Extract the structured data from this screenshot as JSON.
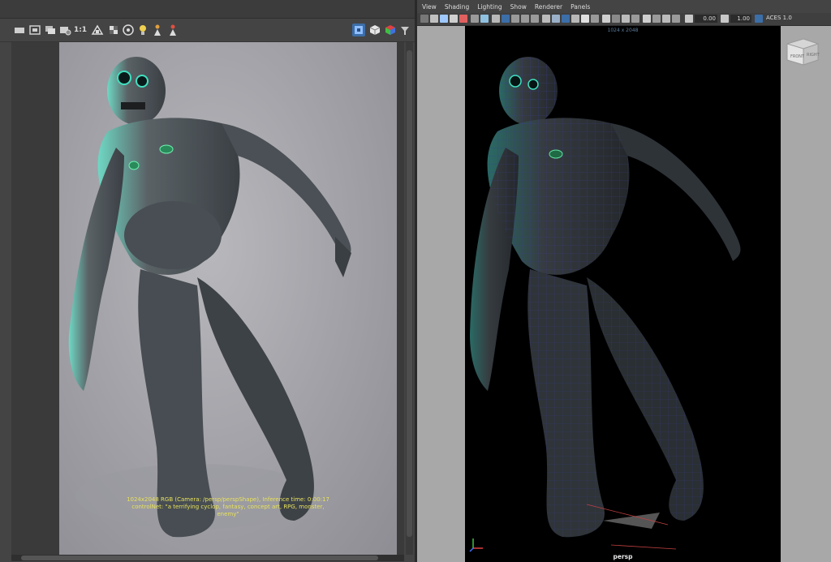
{
  "left_panel": {
    "toolbar": {
      "items": [
        {
          "name": "render-region-icon"
        },
        {
          "name": "snapshot-icon"
        },
        {
          "name": "keep-image-icon"
        },
        {
          "name": "render-settings-icon"
        },
        {
          "name": "real-size-toggle",
          "label": "1:1"
        },
        {
          "name": "color-channels-icon"
        },
        {
          "name": "checker-icon"
        },
        {
          "name": "exposure-icon"
        },
        {
          "name": "light-bulb-icon"
        },
        {
          "name": "render-person-icon"
        },
        {
          "name": "render-person-alt-icon"
        }
      ],
      "right_items": [
        {
          "name": "display-mode-icon",
          "active": true
        },
        {
          "name": "cube-icon"
        },
        {
          "name": "color-cube-icon"
        },
        {
          "name": "filter-icon"
        }
      ]
    },
    "render_info": {
      "line1": "1024x2048 RGB (Camera: /persp/perspShape), Inference time: 0:00:17",
      "line2": "controlNet: \"a terrifying cyclop, fantasy, concept art, RPG, monster, enemy\""
    }
  },
  "viewport": {
    "menu": [
      "View",
      "Shading",
      "Lighting",
      "Show",
      "Renderer",
      "Panels"
    ],
    "fields": {
      "exposure": "0.00",
      "gamma": "1.00",
      "color_space": "ACES 1.0"
    },
    "resolution_gate": "1024 x 2048",
    "camera_name": "persp",
    "view_cube": {
      "front": "FRONT",
      "right": "RIGHT"
    }
  },
  "colors": {
    "ui_dark": "#444444",
    "toolbar_active": "#3c6ea8",
    "info_text": "#e8e25a",
    "creature_glow": "#3fe0c0"
  }
}
